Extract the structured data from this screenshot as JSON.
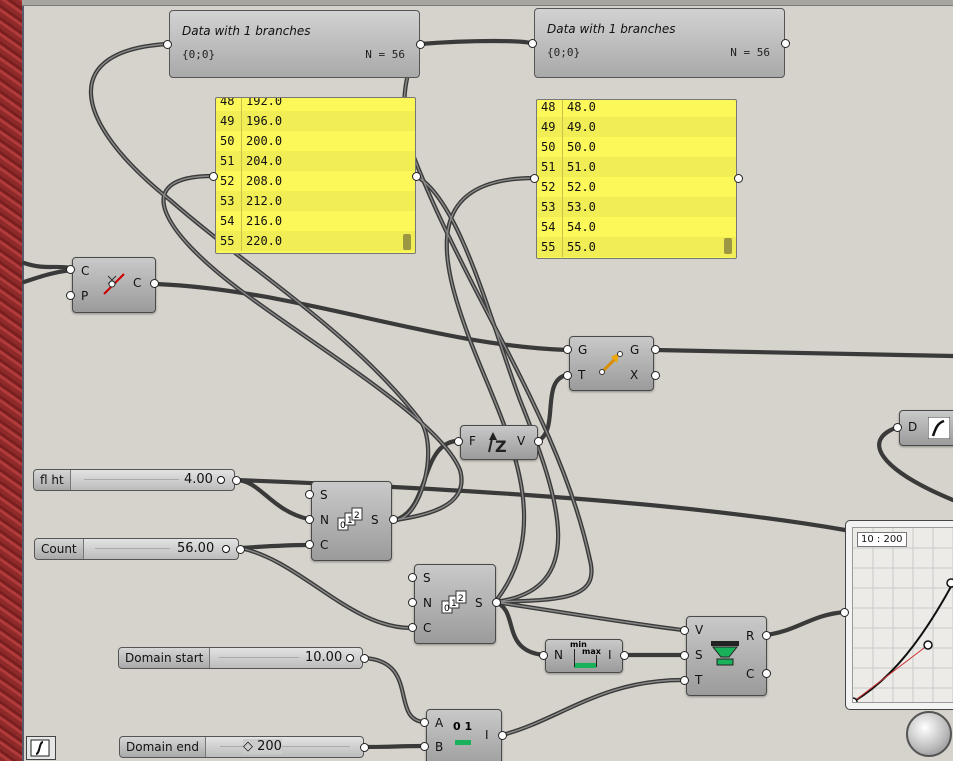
{
  "panels": [
    {
      "title": "Data with 1 branches",
      "path": "{0;0}",
      "count": "N = 56"
    },
    {
      "title": "Data with 1 branches",
      "path": "{0;0}",
      "count": "N = 56"
    }
  ],
  "yellow_panel_left": {
    "rows": [
      {
        "i": "48",
        "v": "192.0"
      },
      {
        "i": "49",
        "v": "196.0"
      },
      {
        "i": "50",
        "v": "200.0"
      },
      {
        "i": "51",
        "v": "204.0"
      },
      {
        "i": "52",
        "v": "208.0"
      },
      {
        "i": "53",
        "v": "212.0"
      },
      {
        "i": "54",
        "v": "216.0"
      },
      {
        "i": "55",
        "v": "220.0"
      }
    ]
  },
  "yellow_panel_right": {
    "rows": [
      {
        "i": "48",
        "v": "48.0"
      },
      {
        "i": "49",
        "v": "49.0"
      },
      {
        "i": "50",
        "v": "50.0"
      },
      {
        "i": "51",
        "v": "51.0"
      },
      {
        "i": "52",
        "v": "52.0"
      },
      {
        "i": "53",
        "v": "53.0"
      },
      {
        "i": "54",
        "v": "54.0"
      },
      {
        "i": "55",
        "v": "55.0"
      }
    ]
  },
  "components": {
    "closest_point": {
      "in1": "C",
      "in2": "P",
      "out": "C"
    },
    "move": {
      "in1": "G",
      "in2": "T",
      "out1": "G",
      "out2": "X"
    },
    "unit_z": {
      "in": "F",
      "out": "V"
    },
    "series1": {
      "in1": "S",
      "in2": "N",
      "in3": "C",
      "out": "S"
    },
    "series2": {
      "in1": "S",
      "in2": "N",
      "in3": "C",
      "out": "S"
    },
    "bounds": {
      "in": "N",
      "out": "I",
      "icon_top": "min",
      "icon_mid": "max"
    },
    "remap": {
      "in1": "V",
      "in2": "S",
      "in3": "T",
      "out1": "R",
      "out2": "C"
    },
    "construct_domain": {
      "in1": "A",
      "in2": "B",
      "out": "I",
      "icon_text": "0 1"
    },
    "graph_mapper_d": {
      "in": "D"
    }
  },
  "sliders": {
    "fl_ht": {
      "label": "fl ht",
      "value": "4.00"
    },
    "count": {
      "label": "Count",
      "value": "56.00"
    },
    "domain_start": {
      "label": "Domain start",
      "value": "10.00"
    },
    "domain_end": {
      "label": "Domain end",
      "value": "◇ 200"
    }
  },
  "graph_mapper": {
    "range_label": "10 : 200"
  },
  "colors": {
    "canvas": "#d6d3cc",
    "panel_yellow": "#fdf859",
    "wire": "#3f3f3f"
  }
}
